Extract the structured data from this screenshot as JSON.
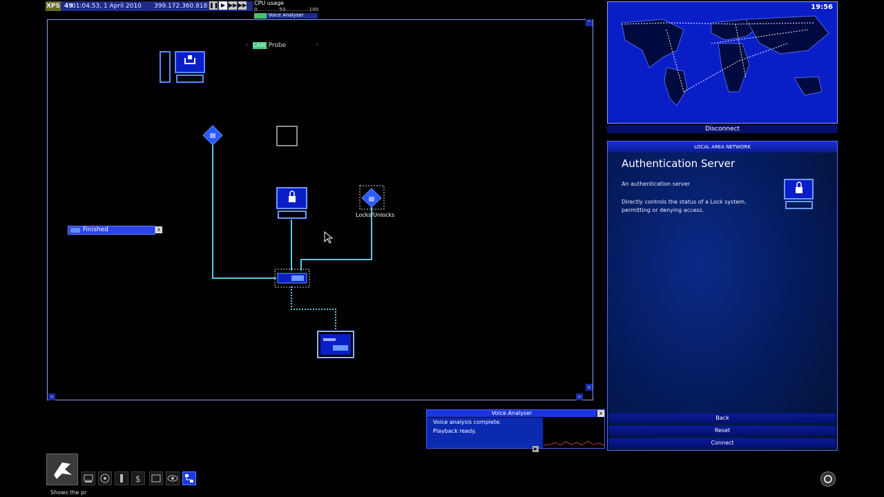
{
  "topbar": {
    "logo": "XPS",
    "speed": "49",
    "datetime": "01:04.53, 1 April 2010",
    "ip": "399.172.360.818",
    "cpu_title": "CPU usage",
    "cpu_scale": "0.............50..............100",
    "cpu_task": "Voice Analyser",
    "cpu_level": 0.2
  },
  "network": {
    "probe_label": "LAN_Probe",
    "finished_label": "Finished",
    "close_symbol": "x",
    "node_lock_label": "Locks/Unlocks",
    "nav": {
      "up": "^",
      "down": "v",
      "left": "<",
      "right": ">"
    }
  },
  "map": {
    "clock": "19:56",
    "disconnect_label": "Disconnect"
  },
  "info": {
    "header": "LOCAL AREA NETWORK",
    "title": "Authentication Server",
    "subtitle": "An authentication server",
    "description": "Directly controls the status of a Lock system, permitting or denying access.",
    "buttons": [
      "Back",
      "Reset",
      "Connect"
    ]
  },
  "voice": {
    "header": "Voice Analyser",
    "line1": "Voice analysis complete.",
    "line2": "Playback ready."
  },
  "taskbar": {
    "hint": "Shows the pr",
    "tools": [
      "computer-icon",
      "gateway-icon",
      "probe-icon",
      "finance-icon",
      "file-icon",
      "eye-icon",
      "network-icon"
    ]
  },
  "colors": {
    "accent": "#1a36e0",
    "link": "#5ec8e8",
    "node": "#5a8aff"
  }
}
